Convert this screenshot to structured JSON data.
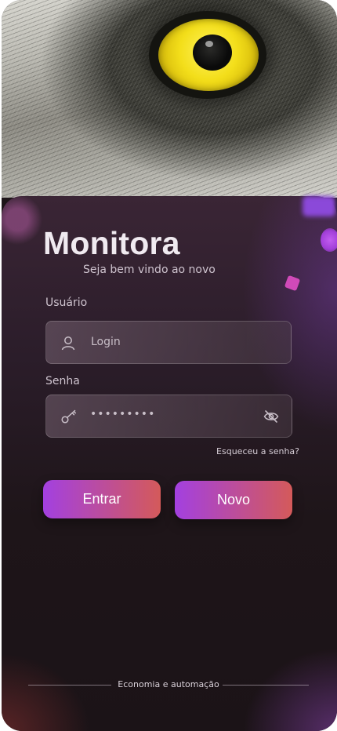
{
  "app": {
    "title": "Monitora",
    "subtitle": "Seja bem vindo ao novo"
  },
  "form": {
    "user_label": "Usuário",
    "user_placeholder": "Login",
    "password_label": "Senha",
    "password_value": "•••••••••",
    "forgot_link": "Esqueceu a senha?"
  },
  "buttons": {
    "login": "Entrar",
    "new": "Novo"
  },
  "footer": {
    "tagline": "Economia e automação"
  },
  "icons": {
    "user": "user-icon",
    "key": "key-icon",
    "eye_off": "eye-off-icon"
  },
  "colors": {
    "gradient_start": "#a340e0",
    "gradient_end": "#d45a5a",
    "background": "#1e1519"
  }
}
